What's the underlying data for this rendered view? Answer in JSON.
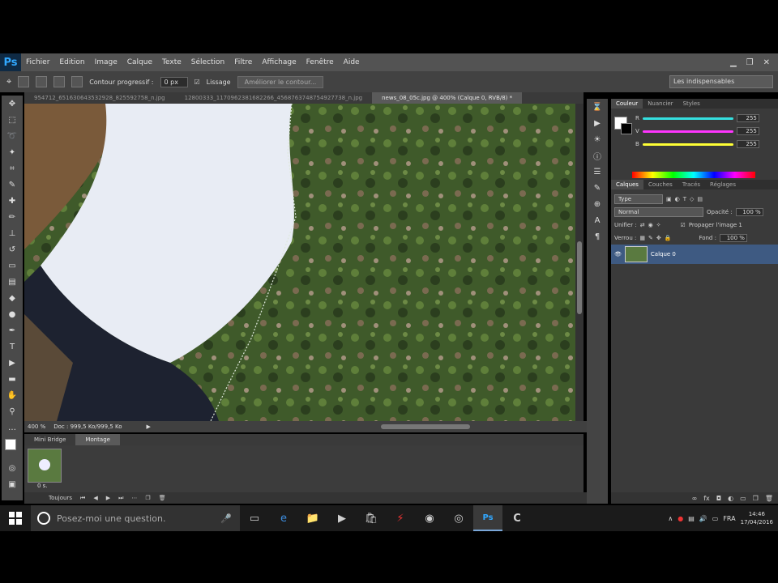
{
  "app": {
    "logo": "Ps"
  },
  "menu": [
    "Fichier",
    "Edition",
    "Image",
    "Calque",
    "Texte",
    "Sélection",
    "Filtre",
    "Affichage",
    "Fenêtre",
    "Aide"
  ],
  "window_controls": {
    "minimize": "▁",
    "restore": "❐",
    "close": "✕"
  },
  "options": {
    "contour_label": "Contour progressif :",
    "contour_value": "0 px",
    "lissage_label": "Lissage",
    "refine_button": "Améliorer le contour...",
    "workspace": "Les indispensables"
  },
  "doc_tabs": [
    "954712_651630643532928_825592758_n.jpg",
    "12800333_1170962381682266_4568763748754927738_n.jpg",
    "news_08_05c.jpg @ 400% (Calque 0, RVB/8) *"
  ],
  "status": {
    "zoom": "400 %",
    "doc": "Doc : 999,5 Ko/999,5 Ko"
  },
  "timeline": {
    "tabs": [
      "Mini Bridge",
      "Montage"
    ],
    "frame_delay": "0 s.",
    "loop": "Toujours"
  },
  "color_panel": {
    "tabs": [
      "Couleur",
      "Nuancier",
      "Styles"
    ],
    "channels": [
      {
        "label": "R",
        "value": "255",
        "color": "#35e0e0"
      },
      {
        "label": "V",
        "value": "255",
        "color": "#ff35ff"
      },
      {
        "label": "B",
        "value": "255",
        "color": "#ffff35"
      }
    ]
  },
  "layers_panel": {
    "tabs": [
      "Calques",
      "Couches",
      "Tracés",
      "Réglages"
    ],
    "kind": "Type",
    "blend_mode": "Normal",
    "opacity_label": "Opacité :",
    "opacity_value": "100 %",
    "unify_label": "Unifier :",
    "propagate_label": "Propager l'image 1",
    "lock_label": "Verrou :",
    "fill_label": "Fond :",
    "fill_value": "100 %",
    "layer_name": "Calque 0"
  },
  "taskbar": {
    "search_placeholder": "Posez-moi une question.",
    "language": "FRA",
    "time": "14:46",
    "date": "17/04/2016"
  }
}
